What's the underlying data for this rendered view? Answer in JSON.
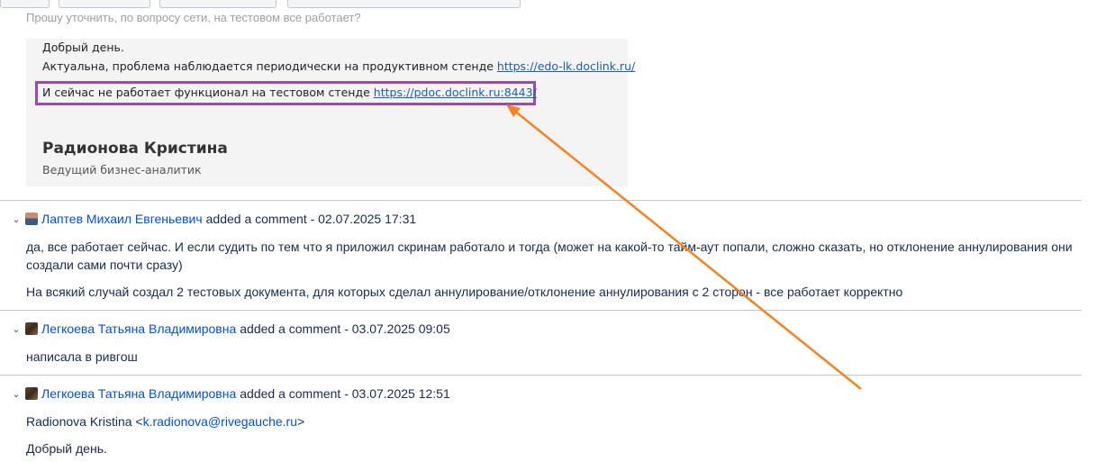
{
  "cut_line": "Прошу уточнить, по вопросу сети, на тестовом все работает?",
  "quote": {
    "greeting": "Добрый день.",
    "line1_text": "Актуальна, проблема наблюдается периодически на продуктивном стенде",
    "line1_link": "https://edo-lk.doclink.ru/",
    "line2_text": "И сейчас не работает функционал на тестовом стенде",
    "line2_link": "https://pdoc.doclink.ru:8443/",
    "signature_name": "Радионова Кристина",
    "signature_role": "Ведущий бизнес-аналитик"
  },
  "comments": [
    {
      "author": "Лаптев Михаил Евгеньевич",
      "action": "added a comment - 02.07.2025 17:31",
      "icon": "user-avatar-icon",
      "paragraphs": [
        "да, все работает сейчас. И если судить по тем что я приложил скринам работало и тогда (может на какой-то тайм-аут попали, сложно сказать, но отклонение аннулирования они создали сами почти сразу)",
        "На всякий случай создал 2 тестовых документа, для которых сделал аннулирование/отклонение аннулирования с 2 сторон - все работает корректно"
      ]
    },
    {
      "author": "Легкоева Татьяна Владимировна",
      "action": "added a comment - 03.07.2025 09:05",
      "icon": "user-avatar-icon",
      "paragraphs": [
        "написала в ривгош"
      ]
    },
    {
      "author": "Легкоева Татьяна Владимировна",
      "action": "added a comment - 03.07.2025 12:51",
      "icon": "user-avatar-icon",
      "from_name": "Radionova Kristina <",
      "from_email": "k.radionova@rivegauche.ru",
      "from_close": ">",
      "paragraphs": [
        "Добрый день."
      ]
    }
  ],
  "colors": {
    "link": "#0052cc",
    "highlight_box": "#9a4aa8",
    "annotation_arrow": "#f5821f"
  }
}
